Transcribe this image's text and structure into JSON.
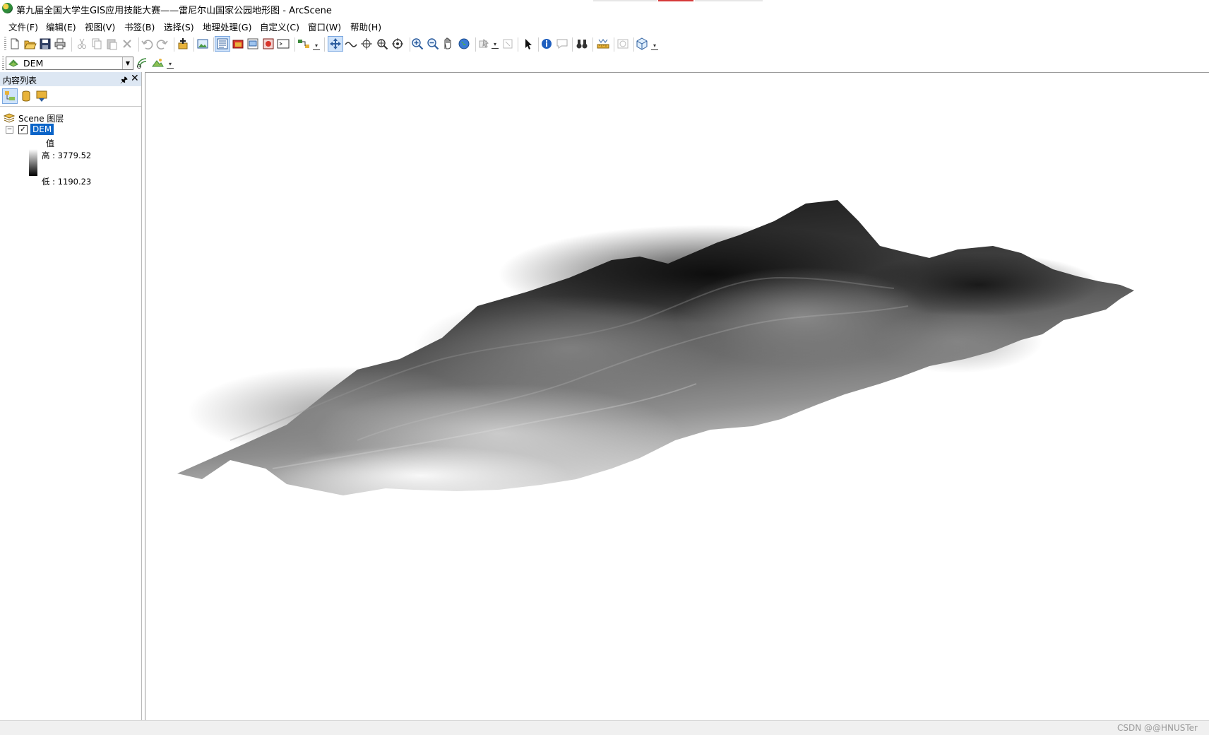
{
  "window": {
    "title": "第九届全国大学生GIS应用技能大赛——雷尼尔山国家公园地形图 - ArcScene"
  },
  "menu": [
    "文件(F)",
    "编辑(E)",
    "视图(V)",
    "书签(B)",
    "选择(S)",
    "地理处理(G)",
    "自定义(C)",
    "窗口(W)",
    "帮助(H)"
  ],
  "layer_selector": {
    "value": "DEM"
  },
  "toc": {
    "title": "内容列表",
    "pin_glyph": "🖈",
    "close_glyph": "✕",
    "scene_layers_label": "Scene 图层",
    "layer": {
      "name": "DEM",
      "checked": true,
      "legend_heading": "值",
      "high_label": "高 : 3779.52",
      "low_label": "低 : 1190.23"
    }
  },
  "status": {
    "watermark": "CSDN @@HNUSTer"
  },
  "colors": {
    "toc_header_bg": "#dde7f3",
    "selection_blue": "#0a64c8",
    "title_accent_red": "#d63a3a"
  },
  "icons": {
    "toolbar": [
      "new-document-icon",
      "open-folder-icon",
      "save-icon",
      "print-icon",
      "cut-icon",
      "copy-icon",
      "paste-icon",
      "delete-icon",
      "undo-icon",
      "redo-icon",
      "add-data-icon",
      "add-image-icon",
      "toc-window-icon",
      "arctoolbox-icon",
      "catalog-icon",
      "search-window-icon",
      "python-window-icon",
      "model-builder-icon",
      "navigate-icon",
      "fly-icon",
      "center-on-target-icon",
      "zoom-to-target-icon",
      "set-observer-icon",
      "zoom-in-icon",
      "zoom-out-icon",
      "pan-hand-icon",
      "full-extent-globe-icon",
      "select-features-icon",
      "clear-selection-icon",
      "select-elements-arrow-icon",
      "identify-icon",
      "html-popup-icon",
      "find-binoculars-icon",
      "measure-icon",
      "time-slider-icon",
      "scene-properties-icon"
    ]
  }
}
